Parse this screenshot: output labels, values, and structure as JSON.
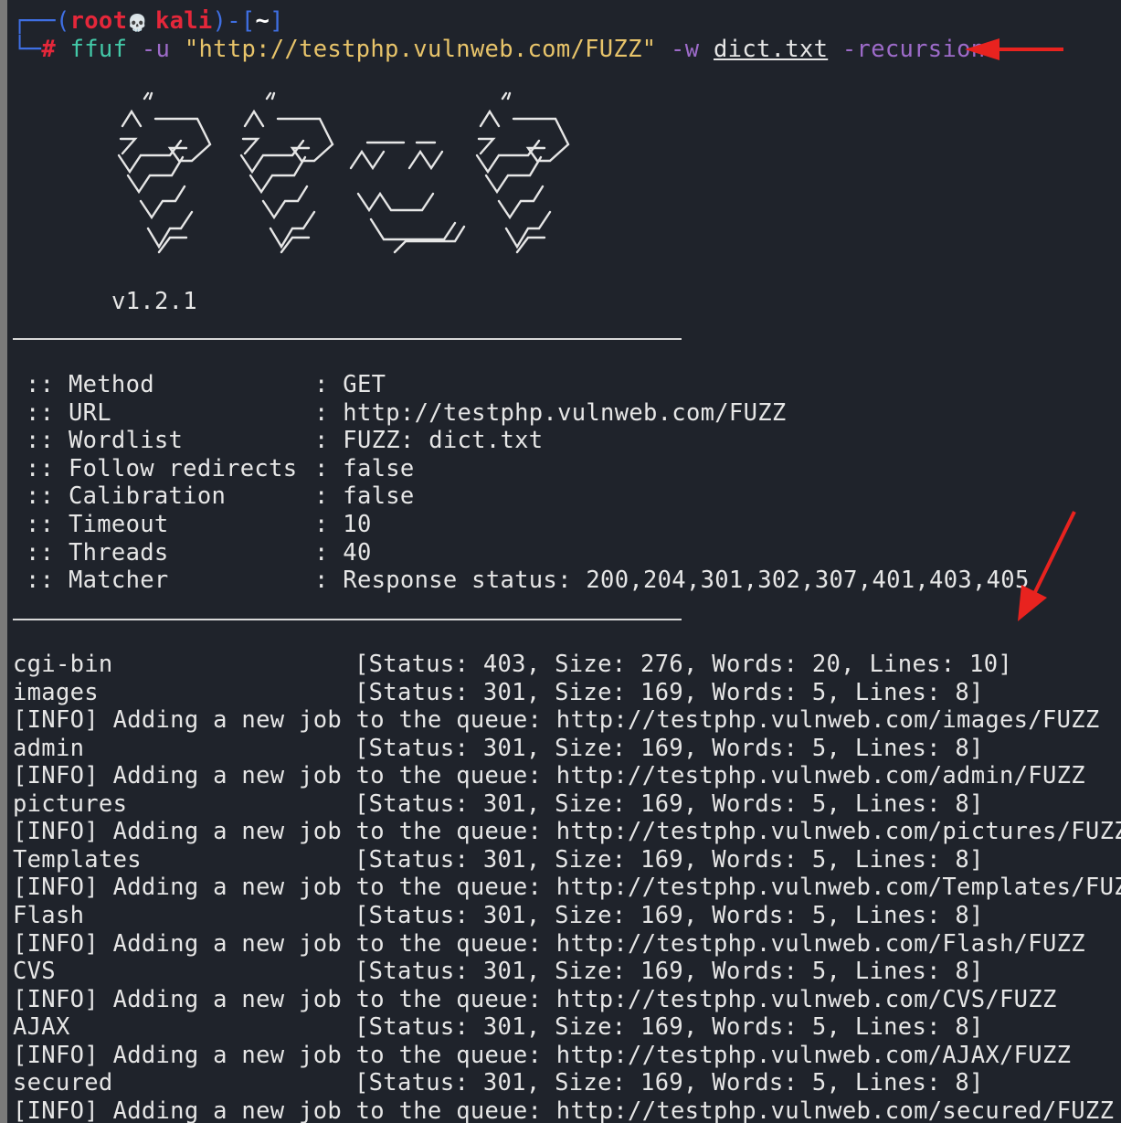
{
  "prompt": {
    "open_bracket": "┌──(",
    "user": "root",
    "skull": "💀",
    "host": "kali",
    "mid": ")-[",
    "cwd": "~",
    "close": "]",
    "second": "└─",
    "hash": "#"
  },
  "command": {
    "tool": "ffuf",
    "flag_u": "-u",
    "url": "\"http://testphp.vulnweb.com/FUZZ\"",
    "flag_w": "-w",
    "wordlist": "dict.txt",
    "flag_recursion": "-recursion"
  },
  "banner": {
    "version": "v1.2.1"
  },
  "config": [
    {
      "key": ":: Method",
      "value": ": GET"
    },
    {
      "key": ":: URL",
      "value": ": http://testphp.vulnweb.com/FUZZ"
    },
    {
      "key": ":: Wordlist",
      "value": ": FUZZ: dict.txt"
    },
    {
      "key": ":: Follow redirects",
      "value": ": false"
    },
    {
      "key": ":: Calibration",
      "value": ": false"
    },
    {
      "key": ":: Timeout",
      "value": ": 10"
    },
    {
      "key": ":: Threads",
      "value": ": 40"
    },
    {
      "key": ":: Matcher",
      "value": ": Response status: 200,204,301,302,307,401,403,405"
    }
  ],
  "results": [
    {
      "name": "cgi-bin",
      "status": "[Status: 403, Size: 276, Words: 20, Lines: 10]"
    },
    {
      "name": "images",
      "status": "[Status: 301, Size: 169, Words: 5, Lines: 8]"
    },
    {
      "info": "[INFO] Adding a new job to the queue: http://testphp.vulnweb.com/images/FUZZ"
    },
    {
      "name": "admin",
      "status": "[Status: 301, Size: 169, Words: 5, Lines: 8]"
    },
    {
      "info": "[INFO] Adding a new job to the queue: http://testphp.vulnweb.com/admin/FUZZ"
    },
    {
      "name": "pictures",
      "status": "[Status: 301, Size: 169, Words: 5, Lines: 8]"
    },
    {
      "info": "[INFO] Adding a new job to the queue: http://testphp.vulnweb.com/pictures/FUZZ"
    },
    {
      "name": "Templates",
      "status": "[Status: 301, Size: 169, Words: 5, Lines: 8]"
    },
    {
      "info": "[INFO] Adding a new job to the queue: http://testphp.vulnweb.com/Templates/FUZZ"
    },
    {
      "name": "Flash",
      "status": "[Status: 301, Size: 169, Words: 5, Lines: 8]"
    },
    {
      "info": "[INFO] Adding a new job to the queue: http://testphp.vulnweb.com/Flash/FUZZ"
    },
    {
      "name": "CVS",
      "status": "[Status: 301, Size: 169, Words: 5, Lines: 8]"
    },
    {
      "info": "[INFO] Adding a new job to the queue: http://testphp.vulnweb.com/CVS/FUZZ"
    },
    {
      "name": "AJAX",
      "status": "[Status: 301, Size: 169, Words: 5, Lines: 8]"
    },
    {
      "info": "[INFO] Adding a new job to the queue: http://testphp.vulnweb.com/AJAX/FUZZ"
    },
    {
      "name": "secured",
      "status": "[Status: 301, Size: 169, Words: 5, Lines: 8]"
    },
    {
      "info": "[INFO] Adding a new job to the queue: http://testphp.vulnweb.com/secured/FUZZ"
    }
  ],
  "annotations": {
    "arrow_color": "#e8231f",
    "arrows": [
      "arrow-pointing-at-recursion-flag",
      "arrow-pointing-at-results"
    ]
  }
}
